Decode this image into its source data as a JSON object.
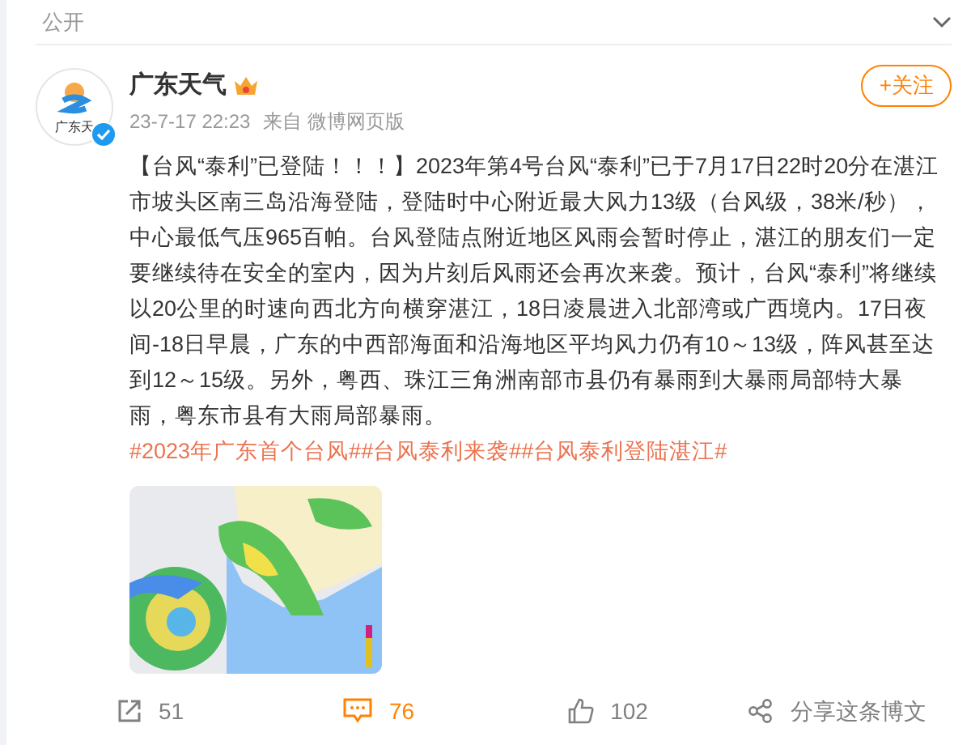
{
  "header": {
    "label": "公开",
    "collapsed": true
  },
  "post": {
    "author": "广东天气",
    "avatar_caption": "广东天",
    "verified": true,
    "crown": true,
    "time": "23-7-17 22:23",
    "source": "来自 微博网页版",
    "follow_button": "+关注",
    "body": [
      {
        "kind": "text",
        "text": "【台风“泰利”已登陆！！！】2023年第4号台风“泰利”已于7月17日22时20分在湛江市坡头区南三岛沿海登陆，登陆时中心附近最大风力13级（台风级，38米/秒），中心最低气压965百帕。台风登陆点附近地区风雨会暂时停止，湛江的朋友们一定要继续待在安全的室内，因为片刻后风雨还会再次来袭。预计，台风“泰利”将继续以20公里的时速向西北方向横穿湛江，18日凌晨进入北部湾或广西境内。17日夜间-18日早晨，广东的中西部海面和沿海地区平均风力仍有10～13级，阵风甚至达到12～15级。另外，粤西、珠江三角洲南部市县仍有暴雨到大暴雨局部特大暴雨，粤东市县有大雨局部暴雨。"
      },
      {
        "kind": "hashtag",
        "text": "#2023年广东首个台风#"
      },
      {
        "kind": "hashtag",
        "text": "#台风泰利来袭#"
      },
      {
        "kind": "hashtag",
        "text": "#台风泰利登陆湛江#"
      }
    ]
  },
  "actions": [
    {
      "kind": "repost",
      "label": "51",
      "selected": false
    },
    {
      "kind": "comment",
      "label": "76",
      "selected": true
    },
    {
      "kind": "like",
      "label": "102",
      "selected": false
    },
    {
      "kind": "share",
      "label": "分享这条博文",
      "selected": false
    }
  ]
}
